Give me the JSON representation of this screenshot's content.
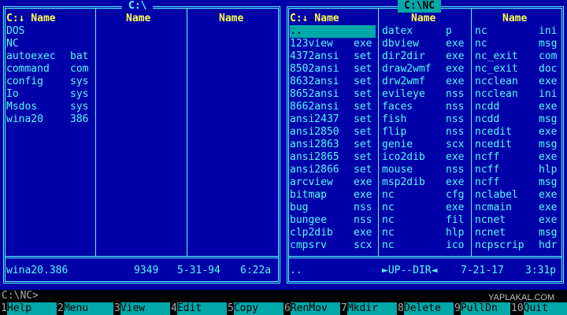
{
  "left_panel": {
    "title": "C:\\",
    "headers": [
      "C:↓ Name",
      "Name",
      "Name"
    ],
    "columns": [
      [
        {
          "name": "DOS",
          "ext": ""
        },
        {
          "name": "NC",
          "ext": ""
        },
        {
          "name": "autoexec",
          "ext": "bat"
        },
        {
          "name": "command",
          "ext": "com"
        },
        {
          "name": "config",
          "ext": "sys"
        },
        {
          "name": "Io",
          "ext": "sys"
        },
        {
          "name": "Msdos",
          "ext": "sys"
        },
        {
          "name": "wina20",
          "ext": "386"
        }
      ],
      [],
      []
    ],
    "status": {
      "file": "wina20.386",
      "size": "9349",
      "date": "5-31-94",
      "time": "6:22a"
    }
  },
  "right_panel": {
    "title": "C:\\NC",
    "headers": [
      "C:↓ Name",
      "Name",
      "Name"
    ],
    "columns": [
      [
        {
          "name": "..",
          "ext": ""
        },
        {
          "name": "123view",
          "ext": "exe"
        },
        {
          "name": "4372ansi",
          "ext": "set"
        },
        {
          "name": "8502ansi",
          "ext": "set"
        },
        {
          "name": "8632ansi",
          "ext": "set"
        },
        {
          "name": "8652ansi",
          "ext": "set"
        },
        {
          "name": "8662ansi",
          "ext": "set"
        },
        {
          "name": "ansi2437",
          "ext": "set"
        },
        {
          "name": "ansi2850",
          "ext": "set"
        },
        {
          "name": "ansi2863",
          "ext": "set"
        },
        {
          "name": "ansi2865",
          "ext": "set"
        },
        {
          "name": "ansi2866",
          "ext": "set"
        },
        {
          "name": "arcview",
          "ext": "exe"
        },
        {
          "name": "bitmap",
          "ext": "exe"
        },
        {
          "name": "bug",
          "ext": "nss"
        },
        {
          "name": "bungee",
          "ext": "nss"
        },
        {
          "name": "clp2dib",
          "ext": "exe"
        },
        {
          "name": "cmpsrv",
          "ext": "scx"
        }
      ],
      [
        {
          "name": "datex",
          "ext": "p"
        },
        {
          "name": "dbview",
          "ext": "exe"
        },
        {
          "name": "dir2dir",
          "ext": "exe"
        },
        {
          "name": "draw2wmf",
          "ext": "exe"
        },
        {
          "name": "drw2wmf",
          "ext": "exe"
        },
        {
          "name": "evileye",
          "ext": "nss"
        },
        {
          "name": "faces",
          "ext": "nss"
        },
        {
          "name": "fish",
          "ext": "nss"
        },
        {
          "name": "flip",
          "ext": "nss"
        },
        {
          "name": "genie",
          "ext": "scx"
        },
        {
          "name": "ico2dib",
          "ext": "exe"
        },
        {
          "name": "mouse",
          "ext": "nss"
        },
        {
          "name": "msp2dib",
          "ext": "exe"
        },
        {
          "name": "nc",
          "ext": "cfg"
        },
        {
          "name": "nc",
          "ext": "exe"
        },
        {
          "name": "nc",
          "ext": "fil"
        },
        {
          "name": "nc",
          "ext": "hlp"
        },
        {
          "name": "nc",
          "ext": "ico"
        }
      ],
      [
        {
          "name": "nc",
          "ext": "ini"
        },
        {
          "name": "nc",
          "ext": "msg"
        },
        {
          "name": "nc_exit",
          "ext": "com"
        },
        {
          "name": "nc_exit",
          "ext": "doc"
        },
        {
          "name": "ncclean",
          "ext": "exe"
        },
        {
          "name": "ncclean",
          "ext": "ini"
        },
        {
          "name": "ncdd",
          "ext": "exe"
        },
        {
          "name": "ncdd",
          "ext": "msg"
        },
        {
          "name": "ncedit",
          "ext": "exe"
        },
        {
          "name": "ncedit",
          "ext": "msg"
        },
        {
          "name": "ncff",
          "ext": "exe"
        },
        {
          "name": "ncff",
          "ext": "hlp"
        },
        {
          "name": "ncff",
          "ext": "msg"
        },
        {
          "name": "nclabel",
          "ext": "exe"
        },
        {
          "name": "ncmain",
          "ext": "exe"
        },
        {
          "name": "ncnet",
          "ext": "exe"
        },
        {
          "name": "ncnet",
          "ext": "msg"
        },
        {
          "name": "ncpscrip",
          "ext": "hdr"
        }
      ]
    ],
    "status": {
      "file": "..",
      "size": "►UP--DIR◄",
      "date": "7-21-17",
      "time": "3:31p"
    }
  },
  "command_line": {
    "prompt": "C:\\NC>"
  },
  "keybar": [
    {
      "num": "1",
      "label": "Help"
    },
    {
      "num": "2",
      "label": "Menu"
    },
    {
      "num": "3",
      "label": "View"
    },
    {
      "num": "4",
      "label": "Edit"
    },
    {
      "num": "5",
      "label": "Copy"
    },
    {
      "num": "6",
      "label": "RenMov"
    },
    {
      "num": "7",
      "label": "Mkdir"
    },
    {
      "num": "8",
      "label": "Delete"
    },
    {
      "num": "9",
      "label": "PullDn"
    },
    {
      "num": "10",
      "label": "Quit"
    }
  ],
  "watermark": "YAPLAKAL.COM",
  "colors": {
    "panel_bg": "#0000a8",
    "text": "#54fcfc",
    "header": "#fcfc54",
    "cursor_bg": "#00a8a8"
  }
}
